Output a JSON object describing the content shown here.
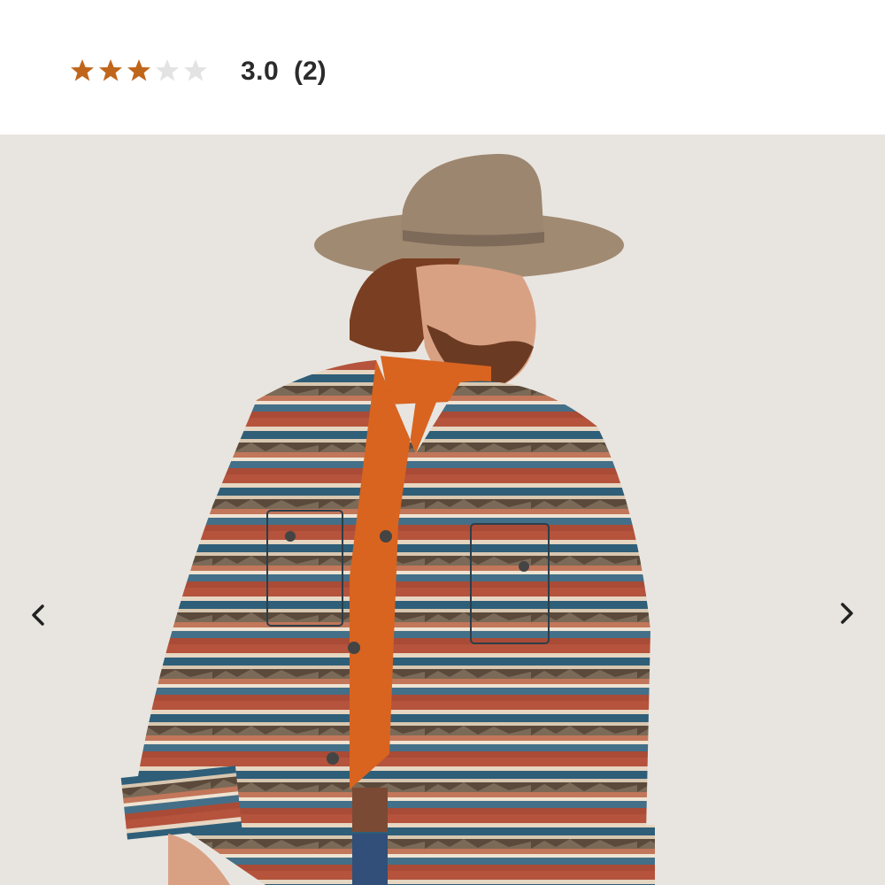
{
  "rating": {
    "value": "3.0",
    "count": "(2)",
    "stars_filled": 3,
    "stars_total": 5,
    "star_color": "#c0661b",
    "star_empty_color": "#e3e3e3"
  },
  "gallery": {
    "image_icon": "product-photo",
    "prev_icon": "chevron-left-icon",
    "next_icon": "chevron-right-icon",
    "arrow_color": "#222222",
    "background": "#e7e3de"
  }
}
